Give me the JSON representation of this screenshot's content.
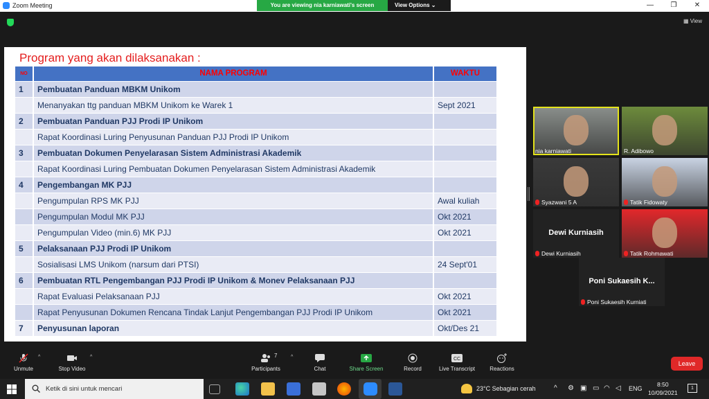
{
  "window": {
    "title": "Zoom Meeting"
  },
  "banner": {
    "message": "You are viewing nia karniawati's screen",
    "view_options": "View Options"
  },
  "header": {
    "view_label": "View"
  },
  "slide": {
    "title": "Program yang akan dilaksanakan :",
    "columns": [
      "NO",
      "NAMA PROGRAM",
      "WAKTU"
    ],
    "rows": [
      {
        "no": "1",
        "name": "Pembuatan Panduan MBKM Unikom",
        "time": "",
        "bold": true
      },
      {
        "no": "",
        "name": "Menanyakan ttg panduan MBKM Unikom ke Warek 1",
        "time": "Sept 2021",
        "bold": false
      },
      {
        "no": "2",
        "name": "Pembuatan Panduan PJJ Prodi IP Unikom",
        "time": "",
        "bold": true
      },
      {
        "no": "",
        "name": "Rapat Koordinasi Luring Penyusunan Panduan PJJ Prodi IP Unikom",
        "time": "",
        "bold": false
      },
      {
        "no": "3",
        "name": "Pembuatan Dokumen Penyelarasan Sistem Administrasi Akademik",
        "time": "",
        "bold": true
      },
      {
        "no": "",
        "name": "Rapat Koordinasi Luring Pembuatan Dokumen Penyelarasan Sistem Administrasi Akademik",
        "time": "",
        "bold": false
      },
      {
        "no": "4",
        "name": "Pengembangan MK PJJ",
        "time": "",
        "bold": true
      },
      {
        "no": "",
        "name": "Pengumpulan RPS MK PJJ",
        "time": "Awal kuliah",
        "bold": false
      },
      {
        "no": "",
        "name": "Pengumpulan Modul MK PJJ",
        "time": "Okt 2021",
        "bold": false
      },
      {
        "no": "",
        "name": "Pengumpulan Video (min.6) MK PJJ",
        "time": "Okt 2021",
        "bold": false
      },
      {
        "no": "5",
        "name": "Pelaksanaan PJJ Prodi IP Unikom",
        "time": "",
        "bold": true
      },
      {
        "no": "",
        "name": "Sosialisasi LMS Unikom (narsum dari PTSI)",
        "time": "24 Sept'01",
        "bold": false
      },
      {
        "no": "6",
        "name": "Pembuatan RTL Pengembangan PJJ Prodi IP Unikom & Monev Pelaksanaan PJJ",
        "time": "",
        "bold": true
      },
      {
        "no": "",
        "name": "Rapat Evaluasi Pelaksanaan PJJ",
        "time": "Okt 2021",
        "bold": false
      },
      {
        "no": "",
        "name": "Rapat Penyusunan Dokumen Rencana Tindak Lanjut Pengembangan PJJ Prodi IP Unikom",
        "time": "Okt 2021",
        "bold": false
      },
      {
        "no": "7",
        "name": "Penyusunan laporan",
        "time": "Okt/Des 21",
        "bold": true
      }
    ]
  },
  "participants": [
    {
      "name": "nia karniawati",
      "video": true,
      "active": true,
      "muted": false,
      "bg": "#8a8f8c"
    },
    {
      "name": "R. Adibowo",
      "video": true,
      "active": false,
      "muted": false,
      "bg": "#6d8b3c"
    },
    {
      "name": "Syazwani 5 A",
      "video": true,
      "active": false,
      "muted": true,
      "bg": "#3a3a3a"
    },
    {
      "name": "Tatik Fidowaty",
      "video": true,
      "active": false,
      "muted": true,
      "bg": "#c9d3e3"
    },
    {
      "name": "Dewi Kurniasih",
      "video": false,
      "active": false,
      "muted": true,
      "display": "Dewi Kurniasih"
    },
    {
      "name": "Tatik Rohmawati",
      "video": true,
      "active": false,
      "muted": true,
      "bg": "#e2282b"
    },
    {
      "name": "Poni Sukaesih Kurniati",
      "video": false,
      "active": false,
      "muted": true,
      "display": "Poni  Sukaesih  K..."
    }
  ],
  "toolbar": {
    "unmute": "Unmute",
    "stop_video": "Stop Video",
    "participants": "Participants",
    "participants_count": "7",
    "chat": "Chat",
    "share_screen": "Share Screen",
    "record": "Record",
    "live_transcript": "Live Transcript",
    "reactions": "Reactions",
    "leave": "Leave"
  },
  "taskbar": {
    "search_placeholder": "Ketik di sini untuk mencari",
    "weather": "23°C  Sebagian cerah",
    "language": "ENG",
    "time": "8:50",
    "date": "10/09/2021",
    "notifications": "1"
  },
  "colors": {
    "accent": "#2d8cff",
    "banner": "#27a844",
    "leave": "#e02828",
    "slide_title": "#e41d1d",
    "table_header": "#4472c4"
  }
}
